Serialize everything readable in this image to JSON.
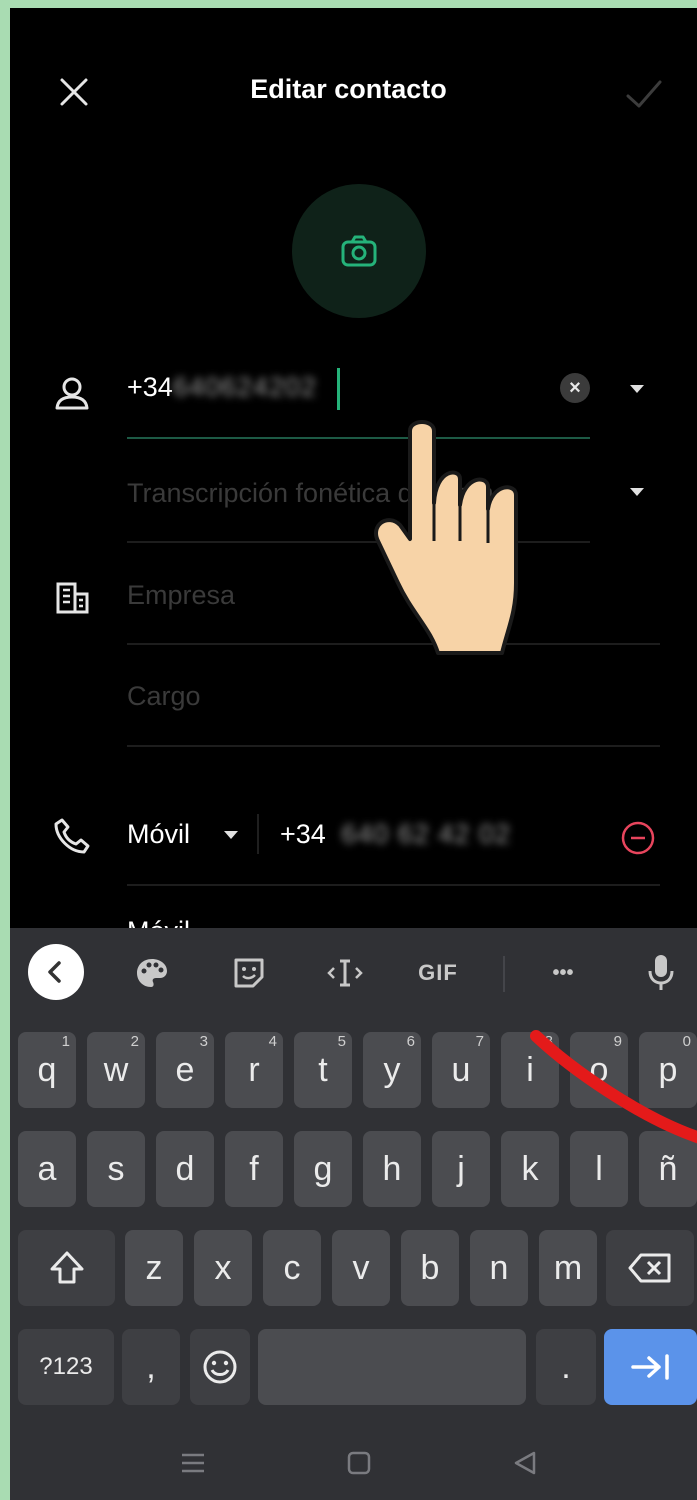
{
  "header": {
    "title": "Editar contacto",
    "close_icon": "close-icon",
    "save_icon": "check-icon"
  },
  "avatar": {
    "icon": "camera-icon",
    "accent": "#25b37a"
  },
  "fields": {
    "name_prefix": "+34",
    "name_blurred": "640624202",
    "phonetic_placeholder": "Transcripción fonética del nom...",
    "company_placeholder": "Empresa",
    "job_placeholder": "Cargo",
    "phone_type": "Móvil",
    "phone_prefix": "+34",
    "phone_blurred": "640 62 42 02",
    "next_row_label": "Móvil"
  },
  "keyboard": {
    "toolbar": [
      "back-icon",
      "palette-icon",
      "sticker-icon",
      "cursor-icon",
      "GIF",
      "more-icon",
      "mic-icon"
    ],
    "gif_label": "GIF",
    "more_label": "•••",
    "row1": [
      {
        "k": "q",
        "h": "1"
      },
      {
        "k": "w",
        "h": "2"
      },
      {
        "k": "e",
        "h": "3"
      },
      {
        "k": "r",
        "h": "4"
      },
      {
        "k": "t",
        "h": "5"
      },
      {
        "k": "y",
        "h": "6"
      },
      {
        "k": "u",
        "h": "7"
      },
      {
        "k": "i",
        "h": "8"
      },
      {
        "k": "o",
        "h": "9"
      },
      {
        "k": "p",
        "h": "0"
      }
    ],
    "row2": [
      "a",
      "s",
      "d",
      "f",
      "g",
      "h",
      "j",
      "k",
      "l",
      "ñ"
    ],
    "row3": [
      "z",
      "x",
      "c",
      "v",
      "b",
      "n",
      "m"
    ],
    "symbols_label": "?123",
    "comma_label": ",",
    "period_label": ".",
    "enter_color": "#5b93ea"
  },
  "colors": {
    "accent": "#25b37a",
    "remove": "#e8455d",
    "background": "#000000"
  }
}
